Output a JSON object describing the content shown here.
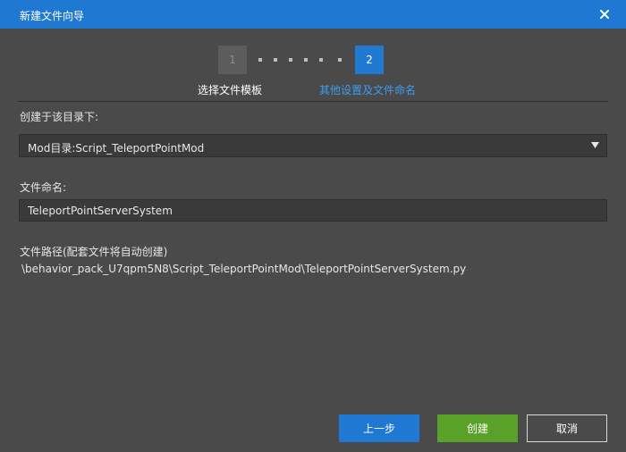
{
  "window": {
    "title": "新建文件向导",
    "close_icon": "close-icon"
  },
  "colors": {
    "titlebar": "#1f78d1",
    "background": "#4a4a4a",
    "field_background": "#3a3a3a",
    "active_step": "#1f78d1",
    "active_step_label": "#3d9cf0",
    "create_button": "#5aa12a"
  },
  "stepper": {
    "steps": [
      {
        "number": "1",
        "label": "选择文件模板",
        "state": "done"
      },
      {
        "number": "2",
        "label": "其他设置及文件命名",
        "state": "active"
      }
    ]
  },
  "form": {
    "directory": {
      "label": "创建于该目录下:",
      "selected": "Mod目录:Script_TeleportPointMod",
      "arrow_icon": "caret-down-icon"
    },
    "filename": {
      "label": "文件命名:",
      "value": "TeleportPointServerSystem"
    },
    "path": {
      "label": "文件路径(配套文件将自动创建)",
      "value": "\\behavior_pack_U7qpm5N8\\Script_TeleportPointMod\\TeleportPointServerSystem.py"
    }
  },
  "buttons": {
    "prev": "上一步",
    "create": "创建",
    "cancel": "取消"
  }
}
